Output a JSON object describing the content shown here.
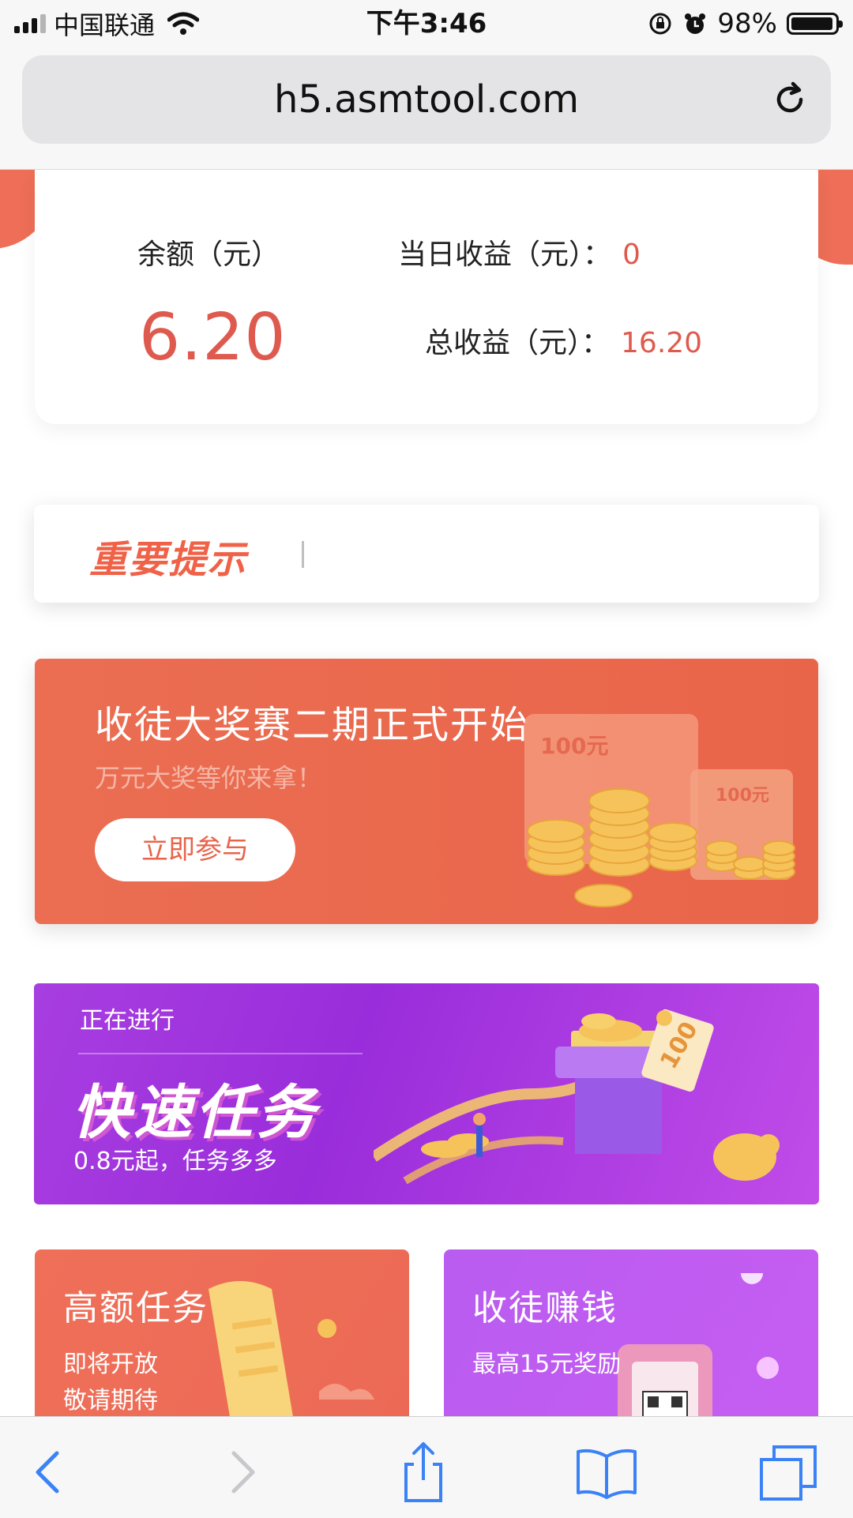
{
  "status_bar": {
    "carrier": "中国联通",
    "time": "下午3:46",
    "battery": "98%"
  },
  "browser": {
    "url": "h5.asmtool.com"
  },
  "balance": {
    "label": "余额（元）",
    "value": "6.20",
    "today_label": "当日收益（元）：",
    "today_value": "0",
    "total_label": "总收益（元）：",
    "total_value": "16.20"
  },
  "notice": {
    "title": "重要提示"
  },
  "promo": {
    "title": "收徒大奖赛二期正式开始",
    "subtitle": "万元大奖等你来拿！",
    "button": "立即参与",
    "bill_label": "100元"
  },
  "quick_task": {
    "status": "正在进行",
    "title": "快速任务",
    "subtitle": "0.8元起，任务多多",
    "ticket_label": "100"
  },
  "tiles": {
    "high_task": {
      "title": "高额任务",
      "line1": "即将开放",
      "line2": "敬请期待"
    },
    "recruit": {
      "title": "收徒赚钱",
      "line1": "最高15元奖励"
    }
  },
  "colors": {
    "accent_red": "#df5a4e",
    "promo_orange": "#eb6e52",
    "banner_purple": "#a73ee0",
    "toolbar_blue": "#3b82f6"
  },
  "icons": {
    "status": [
      "signal-icon",
      "wifi-icon",
      "rotation-lock-icon",
      "alarm-icon",
      "battery-icon"
    ],
    "toolbar": [
      "back-icon",
      "forward-icon",
      "share-icon",
      "bookmarks-icon",
      "tabs-icon"
    ]
  }
}
